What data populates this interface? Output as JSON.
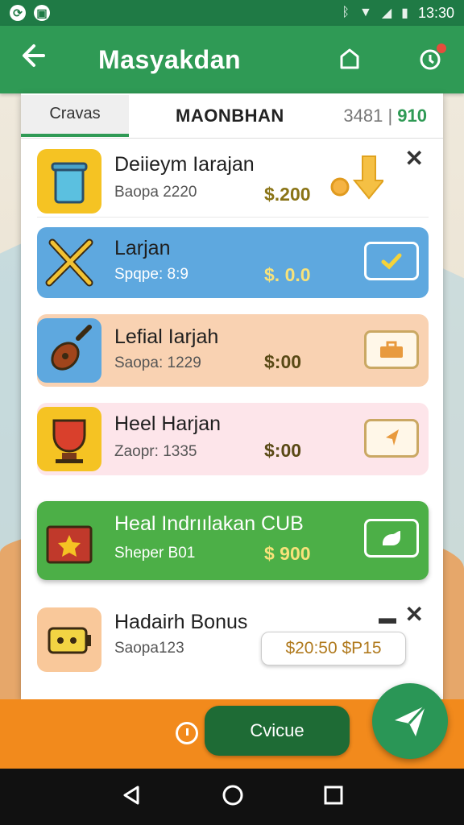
{
  "status_bar": {
    "time": "13:30",
    "left_icons": [
      "sync-icon",
      "image-icon"
    ]
  },
  "app_bar": {
    "title": "Masyakdan"
  },
  "tabs": {
    "active_label": "Cravas",
    "title": "MAONBHAN",
    "count_prefix": "3481",
    "count_value": "910"
  },
  "rows": [
    {
      "name": "Deiieym Iarajan",
      "sub": "Baopa 2220",
      "price": "$.200",
      "thumb": "trash-can-icon"
    },
    {
      "name": "Larjan",
      "sub": "Spqpe: 8:9",
      "price": "$. 0.0",
      "thumb": "tools-icon"
    },
    {
      "name": "Lefial Iarjah",
      "sub": "Saopa: 1229",
      "price": "$:00",
      "thumb": "guitar-icon"
    },
    {
      "name": "Heel Harjan",
      "sub": "Zaopr: 1335",
      "price": "$:00",
      "thumb": "trophy-icon"
    },
    {
      "name": "Heal Indrıılakan CUB",
      "sub": "Sheper B01",
      "price": "$ 900",
      "thumb": "gift-box-icon"
    },
    {
      "name": "Hadairh Bonus",
      "sub": "Saopa123",
      "price": "$20:50 $P15",
      "thumb": "battery-icon"
    }
  ],
  "bottom": {
    "continue_label": "Cvicue"
  },
  "colors": {
    "primary": "#2f9a55",
    "accent": "#f28a1c"
  }
}
